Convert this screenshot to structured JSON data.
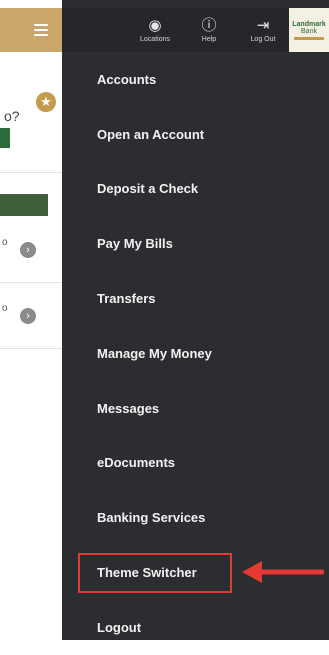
{
  "background_app": {
    "hamburger_icon": "hamburger-icon",
    "card_question_text": "o?",
    "star_icon": "star-icon",
    "rows": [
      {
        "subtext": "o",
        "chevron_icon": "chevron-right-icon"
      },
      {
        "subtext": "o",
        "chevron_icon": "chevron-right-icon"
      }
    ]
  },
  "header": {
    "actions": [
      {
        "label": "Locations",
        "icon": "location-icon"
      },
      {
        "label": "Help",
        "icon": "help-icon"
      },
      {
        "label": "Log Out",
        "icon": "logout-icon"
      }
    ],
    "logo": {
      "line1": "Landmark",
      "line2": "Bank"
    }
  },
  "menu": {
    "items": [
      {
        "label": "Accounts"
      },
      {
        "label": "Open an Account"
      },
      {
        "label": "Deposit a Check"
      },
      {
        "label": "Pay My Bills"
      },
      {
        "label": "Transfers"
      },
      {
        "label": "Manage My Money"
      },
      {
        "label": "Messages"
      },
      {
        "label": "eDocuments"
      },
      {
        "label": "Banking Services"
      },
      {
        "label": "Theme Switcher"
      },
      {
        "label": "Logout"
      }
    ],
    "highlighted_item": "Theme Switcher"
  },
  "colors": {
    "drawer_bg": "#2b2d30",
    "accent_gold": "#c9a66b",
    "highlight_red": "#e53935",
    "brand_green": "#2e6b3a"
  }
}
